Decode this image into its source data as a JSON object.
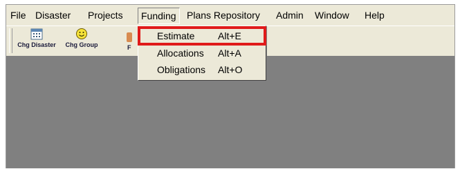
{
  "menubar": {
    "items": [
      "File",
      "Disaster",
      "Projects",
      "Funding",
      "Plans Repository",
      "Admin",
      "Window",
      "Help"
    ],
    "active": "Funding"
  },
  "toolbar": {
    "buttons": [
      {
        "label": "Chg Disaster",
        "icon": "calendar-grid-icon"
      },
      {
        "label": "Chg Group",
        "icon": "smiley-face-icon"
      }
    ],
    "partial_label": "F"
  },
  "funding_menu": {
    "items": [
      {
        "label": "Estimate",
        "shortcut": "Alt+E"
      },
      {
        "label": "Allocations",
        "shortcut": "Alt+A"
      },
      {
        "label": "Obligations",
        "shortcut": "Alt+O"
      }
    ],
    "highlighted": "Estimate",
    "highlight_color": "#e01a1a"
  },
  "colors": {
    "chrome": "#ece9d8",
    "workspace": "#808080"
  }
}
